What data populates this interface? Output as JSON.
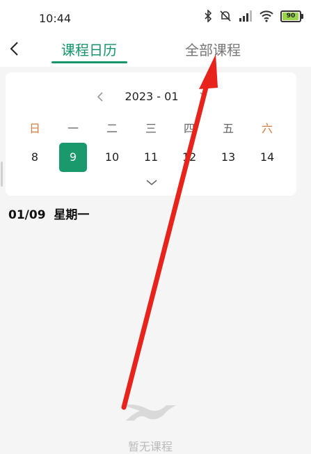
{
  "status_bar": {
    "time": "10:44",
    "battery": "90"
  },
  "header": {
    "tabs": [
      {
        "label": "课程日历",
        "active": true
      },
      {
        "label": "全部课程",
        "active": false
      }
    ]
  },
  "calendar": {
    "month": "2023 - 01",
    "weekdays": [
      "日",
      "一",
      "二",
      "三",
      "四",
      "五",
      "六"
    ],
    "days": [
      "8",
      "9",
      "10",
      "11",
      "12",
      "13",
      "14"
    ],
    "selected_day": "9"
  },
  "selected_date": {
    "date": "01/09",
    "weekday": "星期一"
  },
  "empty_state": {
    "text": "暂无课程"
  },
  "colors": {
    "accent": "#16946b",
    "weekend": "#e07a3c",
    "annotation_arrow": "#e8231c"
  }
}
